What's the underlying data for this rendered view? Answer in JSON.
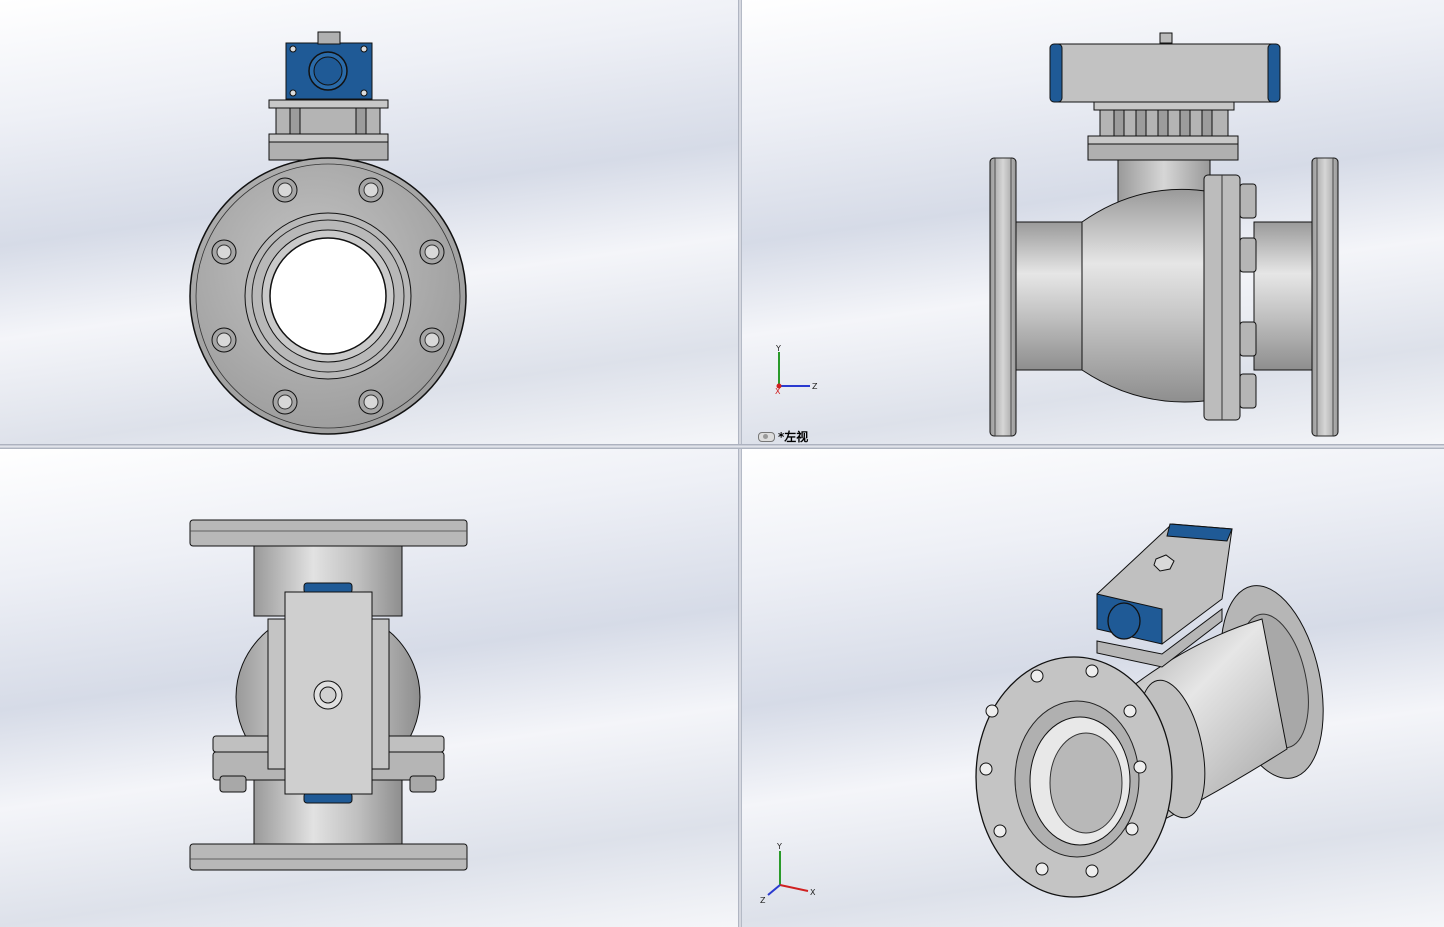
{
  "viewports": {
    "top_left": {
      "name": "front-view"
    },
    "top_right": {
      "name": "left-view",
      "label": "*左视",
      "triad": {
        "y": "Y",
        "z": "Z",
        "x": "X"
      }
    },
    "bottom_left": {
      "name": "top-view"
    },
    "bottom_right": {
      "name": "isometric-view",
      "label": "",
      "triad": {
        "y": "Y",
        "x": "X",
        "z": "Z"
      }
    }
  },
  "colors": {
    "actuator_blue": "#1f5a96",
    "steel": "#b8b8b8",
    "steel_dark": "#8c8c8c",
    "edge": "#1a1a1a"
  }
}
